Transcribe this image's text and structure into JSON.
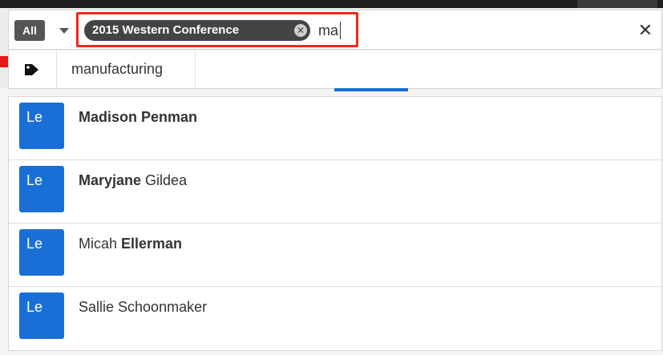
{
  "search": {
    "module_label": "All",
    "tag_label": "2015 Western Conference",
    "query": "ma"
  },
  "tag_suggestions": [
    {
      "label": "manufacturing"
    }
  ],
  "results": [
    {
      "avatar": "Le",
      "name_bold_prefix": "Madison Penman",
      "name_rest": "",
      "name_bold_suffix": ""
    },
    {
      "avatar": "Le",
      "name_bold_prefix": "Maryjane",
      "name_rest": " Gildea",
      "name_bold_suffix": ""
    },
    {
      "avatar": "Le",
      "name_bold_prefix": "",
      "name_rest": "Micah ",
      "name_bold_suffix": "Ellerman"
    },
    {
      "avatar": "Le",
      "name_bold_prefix": "",
      "name_rest": "Sallie Schoonmaker",
      "name_bold_suffix": ""
    }
  ],
  "colors": {
    "accent_blue": "#1a6fd6",
    "highlight_red": "#ef2b1b",
    "pill_dark": "#444444"
  }
}
